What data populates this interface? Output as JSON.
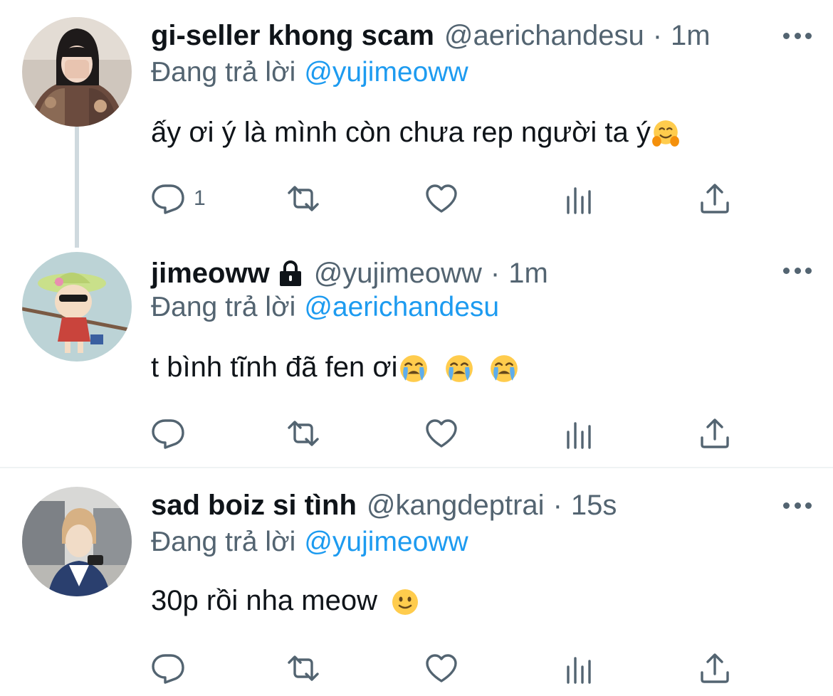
{
  "tweets": [
    {
      "name": "gi-seller khong scam",
      "handle": "@aerichandesu",
      "dot": "·",
      "time": "1m",
      "reply_prefix": "Đang trả lời",
      "reply_mention": "@yujimeoww",
      "text": "ấy ơi ý là mình còn chưa rep người ta ý",
      "emojis": [
        "hugging-face"
      ],
      "reply_count": "1"
    },
    {
      "name": "jimeoww",
      "handle": "@yujimeoww",
      "dot": "·",
      "time": "1m",
      "locked": true,
      "reply_prefix": "Đang trả lời",
      "reply_mention": "@aerichandesu",
      "text": "t bình tĩnh đã fen ơi",
      "emojis": [
        "loudly-crying-face",
        "loudly-crying-face",
        "loudly-crying-face"
      ],
      "reply_count": ""
    },
    {
      "name": "sad boiz si tình",
      "handle": "@kangdeptrai",
      "dot": "·",
      "time": "15s",
      "reply_prefix": "Đang trả lời",
      "reply_mention": "@yujimeoww",
      "text": "30p rồi nha meow",
      "emojis": [
        "slightly-smiling-face"
      ],
      "reply_count": ""
    }
  ],
  "colors": {
    "name": "#0f1419",
    "secondary": "#536471",
    "mention": "#1d9bf0",
    "thread_line": "#cfd9de",
    "divider": "#eff3f4"
  },
  "icons": [
    "reply-icon",
    "retweet-icon",
    "like-icon",
    "analytics-icon",
    "share-icon",
    "more-icon",
    "lock-icon"
  ]
}
